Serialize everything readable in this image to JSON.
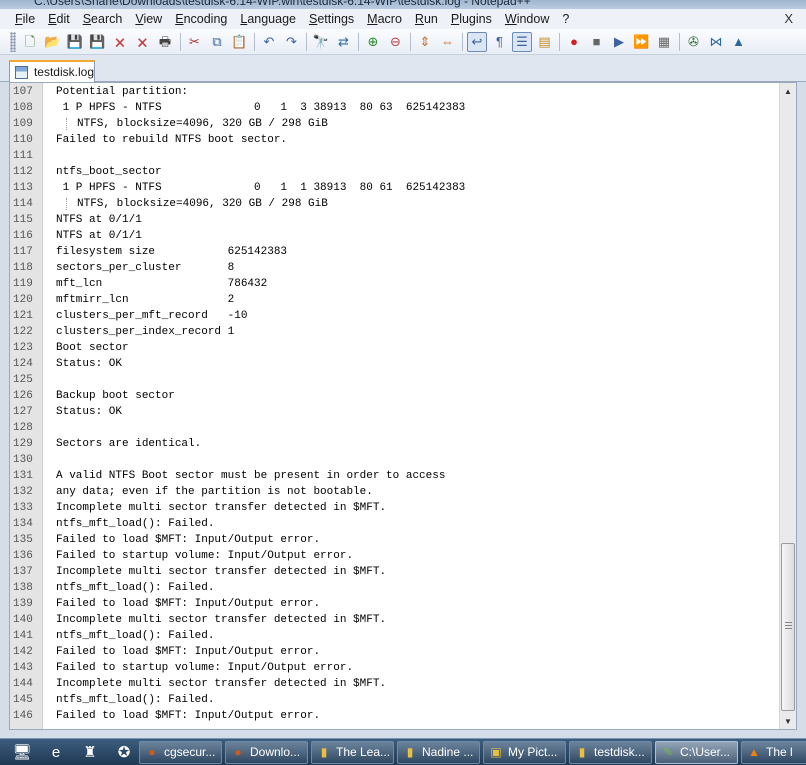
{
  "window": {
    "title": "C:\\Users\\Shane\\Downloads\\testdisk-6.14-WIP.win\\testdisk-6.14-WIP\\testdisk.log - Notepad++",
    "close_glyph": "X"
  },
  "menu": [
    "File",
    "Edit",
    "Search",
    "View",
    "Encoding",
    "Language",
    "Settings",
    "Macro",
    "Run",
    "Plugins",
    "Window",
    "?"
  ],
  "toolbar": [
    {
      "name": "new-file-icon",
      "glyph": "🗋",
      "color": "#3a7d2a"
    },
    {
      "name": "open-file-icon",
      "glyph": "📂",
      "color": "#c8902a"
    },
    {
      "name": "save-icon",
      "glyph": "💾",
      "color": "#3d62a0"
    },
    {
      "name": "save-all-icon",
      "glyph": "💾",
      "color": "#3d62a0"
    },
    {
      "name": "close-icon",
      "glyph": "🗙",
      "color": "#c04040"
    },
    {
      "name": "close-all-icon",
      "glyph": "🗙",
      "color": "#c04040"
    },
    {
      "name": "print-icon",
      "glyph": "🖶",
      "color": "#444444"
    },
    {
      "sep": true
    },
    {
      "name": "cut-icon",
      "glyph": "✂",
      "color": "#b03030"
    },
    {
      "name": "copy-icon",
      "glyph": "⧉",
      "color": "#3d62a0"
    },
    {
      "name": "paste-icon",
      "glyph": "📋",
      "color": "#8a6a30"
    },
    {
      "sep": true
    },
    {
      "name": "undo-icon",
      "glyph": "↶",
      "color": "#3d62a0"
    },
    {
      "name": "redo-icon",
      "glyph": "↷",
      "color": "#3d62a0"
    },
    {
      "sep": true
    },
    {
      "name": "find-icon",
      "glyph": "🔭",
      "color": "#333333"
    },
    {
      "name": "replace-icon",
      "glyph": "⇄",
      "color": "#2a6aa0"
    },
    {
      "sep": true
    },
    {
      "name": "zoom-in-icon",
      "glyph": "⊕",
      "color": "#2a8a2a"
    },
    {
      "name": "zoom-out-icon",
      "glyph": "⊖",
      "color": "#c04040"
    },
    {
      "sep": true
    },
    {
      "name": "sync-vertical-icon",
      "glyph": "⇕",
      "color": "#c07030"
    },
    {
      "name": "sync-horizontal-icon",
      "glyph": "⇔",
      "color": "#c07030"
    },
    {
      "sep": true
    },
    {
      "name": "word-wrap-icon",
      "glyph": "↩",
      "color": "#3d62a0",
      "active": true
    },
    {
      "name": "show-all-chars-icon",
      "glyph": "¶",
      "color": "#3d62a0"
    },
    {
      "name": "indent-guide-icon",
      "glyph": "☰",
      "color": "#3d62a0",
      "active": true
    },
    {
      "name": "user-lang-icon",
      "glyph": "▤",
      "color": "#c08a20"
    },
    {
      "sep": true
    },
    {
      "name": "record-macro-icon",
      "glyph": "●",
      "color": "#d02020"
    },
    {
      "name": "stop-record-icon",
      "glyph": "■",
      "color": "#666666"
    },
    {
      "name": "playback-icon",
      "glyph": "▶",
      "color": "#3d62a0"
    },
    {
      "name": "run-multiple-icon",
      "glyph": "⏩",
      "color": "#3d62a0"
    },
    {
      "name": "save-macro-icon",
      "glyph": "▦",
      "color": "#666666"
    },
    {
      "sep": true
    },
    {
      "name": "plugin-1-icon",
      "glyph": "✇",
      "color": "#2a6a2a"
    },
    {
      "name": "plugin-2-icon",
      "glyph": "⋈",
      "color": "#2a6aa0"
    },
    {
      "name": "plugin-3-icon",
      "glyph": "▲",
      "color": "#2a6aa0"
    }
  ],
  "tabs": [
    {
      "label": "testdisk.log"
    }
  ],
  "editor": {
    "lines": [
      {
        "n": "107",
        "text": "Potential partition:"
      },
      {
        "n": "108",
        "text": " 1 P HPFS - NTFS              0   1  3 38913  80 63  625142383"
      },
      {
        "n": "109",
        "text": "NTFS, blocksize=4096, 320 GB / 298 GiB",
        "indent": true
      },
      {
        "n": "110",
        "text": "Failed to rebuild NTFS boot sector."
      },
      {
        "n": "111",
        "text": ""
      },
      {
        "n": "112",
        "text": "ntfs_boot_sector"
      },
      {
        "n": "113",
        "text": " 1 P HPFS - NTFS              0   1  1 38913  80 61  625142383"
      },
      {
        "n": "114",
        "text": "NTFS, blocksize=4096, 320 GB / 298 GiB",
        "indent": true
      },
      {
        "n": "115",
        "text": "NTFS at 0/1/1"
      },
      {
        "n": "116",
        "text": "NTFS at 0/1/1"
      },
      {
        "n": "117",
        "text": "filesystem size           625142383"
      },
      {
        "n": "118",
        "text": "sectors_per_cluster       8"
      },
      {
        "n": "119",
        "text": "mft_lcn                   786432"
      },
      {
        "n": "120",
        "text": "mftmirr_lcn               2"
      },
      {
        "n": "121",
        "text": "clusters_per_mft_record   -10"
      },
      {
        "n": "122",
        "text": "clusters_per_index_record 1"
      },
      {
        "n": "123",
        "text": "Boot sector"
      },
      {
        "n": "124",
        "text": "Status: OK"
      },
      {
        "n": "125",
        "text": ""
      },
      {
        "n": "126",
        "text": "Backup boot sector"
      },
      {
        "n": "127",
        "text": "Status: OK"
      },
      {
        "n": "128",
        "text": ""
      },
      {
        "n": "129",
        "text": "Sectors are identical."
      },
      {
        "n": "130",
        "text": ""
      },
      {
        "n": "131",
        "text": "A valid NTFS Boot sector must be present in order to access"
      },
      {
        "n": "132",
        "text": "any data; even if the partition is not bootable."
      },
      {
        "n": "133",
        "text": "Incomplete multi sector transfer detected in $MFT."
      },
      {
        "n": "134",
        "text": "ntfs_mft_load(): Failed."
      },
      {
        "n": "135",
        "text": "Failed to load $MFT: Input/Output error."
      },
      {
        "n": "136",
        "text": "Failed to startup volume: Input/Output error."
      },
      {
        "n": "137",
        "text": "Incomplete multi sector transfer detected in $MFT."
      },
      {
        "n": "138",
        "text": "ntfs_mft_load(): Failed."
      },
      {
        "n": "139",
        "text": "Failed to load $MFT: Input/Output error."
      },
      {
        "n": "140",
        "text": "Incomplete multi sector transfer detected in $MFT."
      },
      {
        "n": "141",
        "text": "ntfs_mft_load(): Failed."
      },
      {
        "n": "142",
        "text": "Failed to load $MFT: Input/Output error."
      },
      {
        "n": "143",
        "text": "Failed to startup volume: Input/Output error."
      },
      {
        "n": "144",
        "text": "Incomplete multi sector transfer detected in $MFT."
      },
      {
        "n": "145",
        "text": "ntfs_mft_load(): Failed."
      },
      {
        "n": "146",
        "text": "Failed to load $MFT: Input/Output error."
      }
    ]
  },
  "taskbar": {
    "quicklaunch": [
      {
        "name": "show-desktop-icon",
        "glyph": "🖥"
      },
      {
        "name": "internet-explorer-icon",
        "glyph": "e"
      },
      {
        "name": "app-icon",
        "glyph": "♜"
      },
      {
        "name": "media-icon",
        "glyph": "✪"
      }
    ],
    "tasks": [
      {
        "label": "cgsecur...",
        "icon": "firefox-icon",
        "color": "#d05a1a",
        "glyph": "●"
      },
      {
        "label": "Downlo...",
        "icon": "firefox-icon",
        "color": "#d05a1a",
        "glyph": "●"
      },
      {
        "label": "The Lea...",
        "icon": "folder-icon",
        "color": "#e8c040",
        "glyph": "▮"
      },
      {
        "label": "Nadine ...",
        "icon": "folder-icon",
        "color": "#e8c040",
        "glyph": "▮"
      },
      {
        "label": "My Pict...",
        "icon": "pictures-icon",
        "color": "#e8c040",
        "glyph": "▣"
      },
      {
        "label": "testdisk...",
        "icon": "folder-icon",
        "color": "#e8c040",
        "glyph": "▮"
      },
      {
        "label": "C:\\User...",
        "icon": "notepadpp-icon",
        "color": "#7ab24a",
        "glyph": "✎",
        "active": true
      },
      {
        "label": "The l",
        "icon": "vlc-icon",
        "color": "#f08010",
        "glyph": "▲"
      }
    ]
  }
}
